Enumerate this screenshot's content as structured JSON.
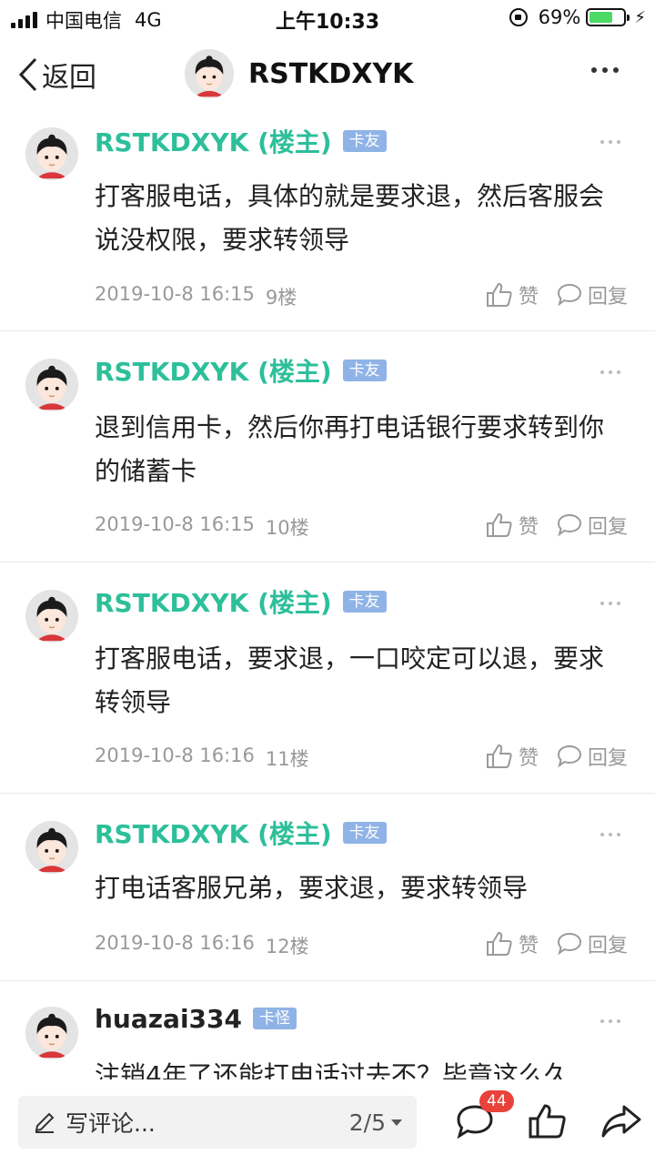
{
  "status_bar": {
    "carrier": "中国电信",
    "network": "4G",
    "time": "上午10:33",
    "battery_percent": "69%",
    "battery_level": 0.69,
    "battery_color": "#4cd964"
  },
  "nav": {
    "back_label": "返回",
    "title": "RSTKDXYK"
  },
  "posts": [
    {
      "username": "RSTKDXYK (楼主)",
      "badge": "卡友",
      "text": "打客服电话，具体的就是要求退，然后客服会说没权限，要求转领导",
      "date": "2019-10-8 16:15",
      "floor": "9楼",
      "like_label": "赞",
      "reply_label": "回复"
    },
    {
      "username": "RSTKDXYK (楼主)",
      "badge": "卡友",
      "text": "退到信用卡，然后你再打电话银行要求转到你的储蓄卡",
      "date": "2019-10-8 16:15",
      "floor": "10楼",
      "like_label": "赞",
      "reply_label": "回复"
    },
    {
      "username": "RSTKDXYK (楼主)",
      "badge": "卡友",
      "text": "打客服电话，要求退，一口咬定可以退，要求转领导",
      "date": "2019-10-8 16:16",
      "floor": "11楼",
      "like_label": "赞",
      "reply_label": "回复"
    },
    {
      "username": "RSTKDXYK (楼主)",
      "badge": "卡友",
      "text": "打电话客服兄弟，要求退，要求转领导",
      "date": "2019-10-8 16:16",
      "floor": "12楼",
      "like_label": "赞",
      "reply_label": "回复"
    },
    {
      "username": "huazai334",
      "badge": "卡怪",
      "text": "注销4年了还能打电话过去不？毕竟这么久"
    }
  ],
  "bottom_bar": {
    "comment_placeholder": "写评论...",
    "page_indicator": "2/5",
    "comment_count": "44"
  },
  "colors": {
    "accent_username": "#2dbf9a",
    "badge_bg": "#8fb3e6",
    "count_badge": "#e9423a"
  }
}
